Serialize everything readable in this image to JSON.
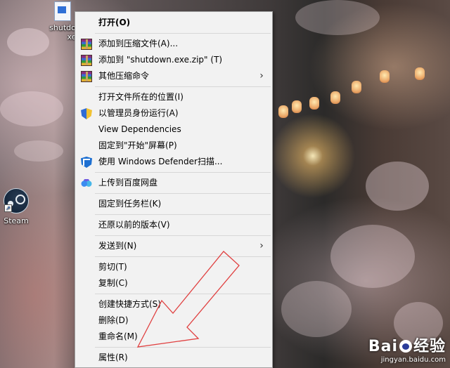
{
  "desktop": {
    "icons": [
      {
        "label_line1": "shutdo",
        "label_line2": "xe",
        "icon": "exe-file-icon"
      },
      {
        "label": "Steam",
        "icon": "steam-icon"
      }
    ]
  },
  "context_menu": {
    "items": [
      {
        "label": "打开(O)",
        "bold": true
      },
      {
        "label": "添加到压缩文件(A)...",
        "icon": "winrar-icon"
      },
      {
        "label": "添加到 \"shutdown.exe.zip\" (T)",
        "icon": "winrar-icon"
      },
      {
        "label": "其他压缩命令",
        "icon": "winrar-icon",
        "submenu": true
      },
      {
        "label": "打开文件所在的位置(I)"
      },
      {
        "label": "以管理员身份运行(A)",
        "icon": "uac-shield-icon"
      },
      {
        "label": "View Dependencies"
      },
      {
        "label": "固定到\"开始\"屏幕(P)"
      },
      {
        "label": "使用 Windows Defender扫描...",
        "icon": "windows-defender-icon"
      },
      {
        "label": "上传到百度网盘",
        "icon": "baidu-netdisk-icon"
      },
      {
        "label": "固定到任务栏(K)"
      },
      {
        "label": "还原以前的版本(V)"
      },
      {
        "label": "发送到(N)",
        "submenu": true
      },
      {
        "label": "剪切(T)"
      },
      {
        "label": "复制(C)"
      },
      {
        "label": "创建快捷方式(S)"
      },
      {
        "label": "删除(D)"
      },
      {
        "label": "重命名(M)"
      },
      {
        "label": "属性(R)"
      }
    ],
    "submenu_glyph": "›"
  },
  "annotation": {
    "color": "#e04040"
  },
  "watermark": {
    "brand_left": "Bai",
    "brand_right": "经验",
    "url": "jingyan.baidu.com"
  }
}
